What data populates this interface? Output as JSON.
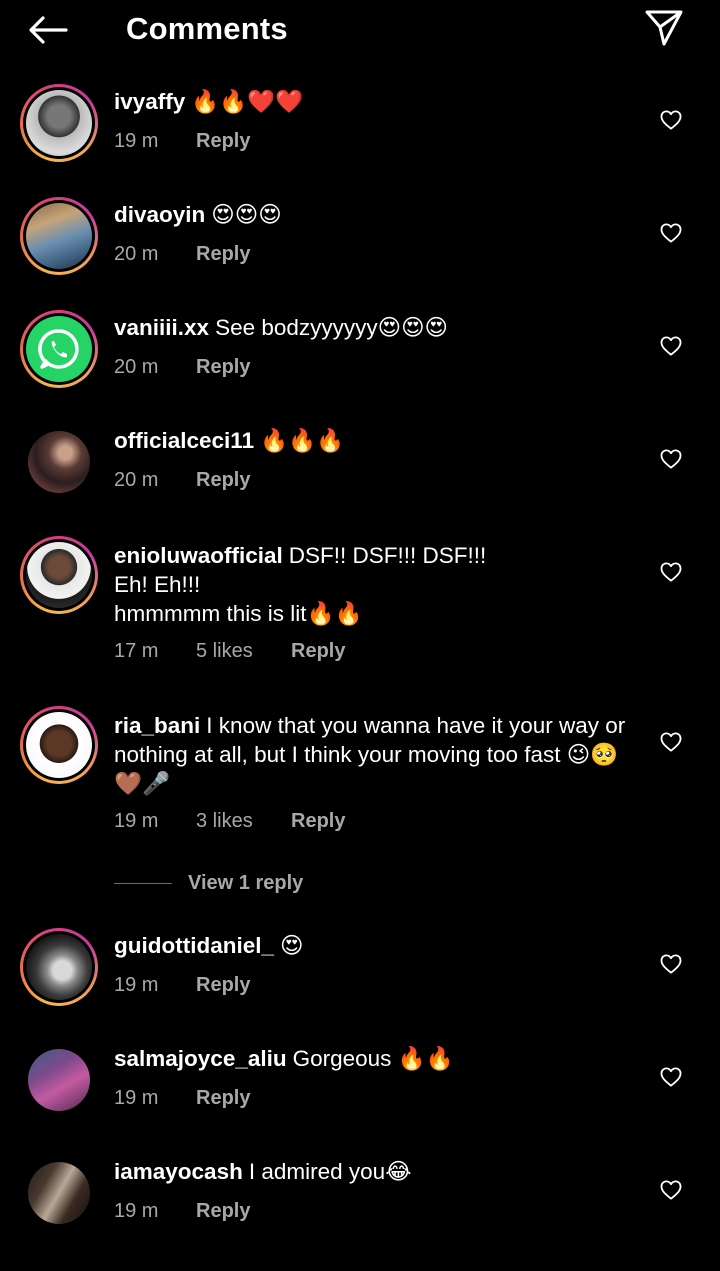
{
  "header": {
    "title": "Comments",
    "back_icon": "arrow-left-icon",
    "share_icon": "paper-plane-icon"
  },
  "colors": {
    "background": "#000000",
    "text": "#ffffff",
    "meta": "#a8a8a8",
    "story_ring": [
      "#f7b74a",
      "#e9694c",
      "#d9407d",
      "#c43b9c"
    ]
  },
  "comments": [
    {
      "username": "ivyaffy",
      "text": "🔥🔥❤️❤️",
      "time": "19 m",
      "likes": "",
      "reply": "Reply"
    },
    {
      "username": "divaoyin",
      "text": "😍😍😍",
      "time": "20 m",
      "likes": "",
      "reply": "Reply"
    },
    {
      "username": "vaniiii.xx",
      "text": "See bodzyyyyyy😍😍😍",
      "time": "20 m",
      "likes": "",
      "reply": "Reply"
    },
    {
      "username": "officialceci11",
      "text": "🔥🔥🔥",
      "time": "20 m",
      "likes": "",
      "reply": "Reply"
    },
    {
      "username": "enioluwaofficial",
      "text": "DSF!! DSF!!! DSF!!!",
      "text_line2": "Eh! Eh!!!",
      "text_line3": "hmmmmm this is lit🔥🔥",
      "time": "17 m",
      "likes": "5 likes",
      "reply": "Reply"
    },
    {
      "username": "ria_bani",
      "text": "I know that you wanna have it your way or nothing at all, but I think your moving too fast 😉🥺🤎🎤",
      "time": "19 m",
      "likes": "3 likes",
      "reply": "Reply"
    },
    {
      "username": "guidottidaniel_",
      "text": "😍",
      "time": "19 m",
      "likes": "",
      "reply": "Reply"
    },
    {
      "username": "salmajoyce_aliu",
      "text": "Gorgeous 🔥🔥",
      "time": "19 m",
      "likes": "",
      "reply": "Reply"
    },
    {
      "username": "iamayocash",
      "text": "I admired you😂",
      "time": "19 m",
      "likes": "",
      "reply": "Reply"
    }
  ],
  "view_replies": {
    "label": "View 1 reply"
  }
}
